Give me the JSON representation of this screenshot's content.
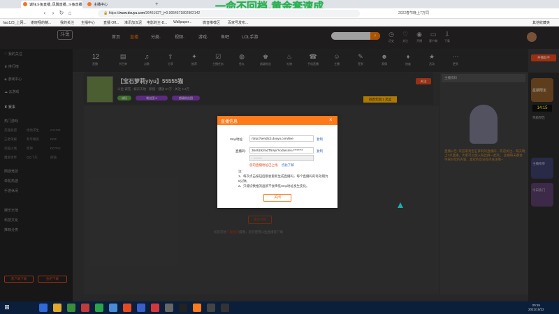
{
  "browser": {
    "tabs": [
      {
        "label": "诚钰斗鱼直播_凤翼直播_斗鱼直播",
        "active": true
      },
      {
        "label": "主播中心",
        "active": false
      }
    ],
    "new_tab": "+",
    "url_host": "www.douyu.com",
    "url_path": "/3646192?_j=0.9054571802902142",
    "url_prefix": "https://",
    "news_hint": "2022春节晚上7万同"
  },
  "banner": {
    "text": "一命不回档,黄金套速成"
  },
  "bookmarks": [
    "hao123_上网...",
    "谢晓翔的精...",
    "我的关注",
    "主播中心",
    "直播 Off...",
    "准讯加汉泥",
    "电影的主-D...",
    "Wallpaper...",
    "微音推荐区",
    "百家号发布..."
  ],
  "bookmarks_right": "其他收藏夹",
  "header": {
    "logo": "斗鱼",
    "nav": [
      {
        "label": "首页",
        "on": false
      },
      {
        "label": "直播",
        "on": true
      },
      {
        "label": "分类·",
        "on": false
      },
      {
        "label": "视频·",
        "on": false
      },
      {
        "label": "游戏·",
        "on": false
      },
      {
        "label": "鱼吧",
        "on": false
      },
      {
        "label": "LOL手游",
        "on": false
      }
    ],
    "search_icon": "search-icon",
    "icons": [
      "历史",
      "关注",
      "开播",
      "客户端",
      "下载"
    ]
  },
  "sidebar": {
    "items": [
      "我的关注",
      "排行榜",
      "游戏中心",
      "云游戏",
      "赛事",
      "热门游戏",
      "网游竞技",
      "单机热游",
      "手游休闲",
      "娱乐天地",
      "科技文化",
      "推荐分类"
    ],
    "sub": [
      [
        "英雄联盟",
        "绝地求生",
        "CS:GO"
      ],
      [
        "王者荣耀",
        "和平精英",
        "DNF"
      ],
      [
        "穿越火线",
        "原神",
        "DOTA2"
      ],
      [
        "魔兽世界",
        "QQ飞车",
        "颜值"
      ]
    ],
    "buttons": [
      "客户端下载",
      "鱼吧下载"
    ]
  },
  "toolbar": {
    "count": "12",
    "count_label": "直播",
    "items": [
      "节目单",
      "点歌",
      "分享",
      "推荐",
      "主播任务",
      "鱼丸",
      "超级粉丝",
      "礼物",
      "手机直播",
      "主播",
      "签到",
      "表情",
      "热度",
      "活动",
      "更多"
    ],
    "right_button": "开播助手"
  },
  "room": {
    "title": "【宝石萝莉yiyu】55555猫",
    "meta": "斗鱼 诚钰 · 娱乐天地 · 颜值 · 播放 57万 · 关注 4.3万",
    "pills": [
      "诚钰",
      "粉丝团 6",
      "超级粉丝团"
    ],
    "tag": "四百年回 1 次运",
    "follow": "关注"
  },
  "modal": {
    "title": "直播信息",
    "close_icon": "×",
    "rtmp_label": "rtmp地址:",
    "rtmp_value": "rtmp://sendtc3.douyu.com/live",
    "code_label": "直播码:",
    "code_value": "3646192rndT5Vyir?xxSecret=********",
    "copy": "复制",
    "select_value": "· --------",
    "warning": "您的直播地址已上线",
    "help_link": "点此了解",
    "notes_title": "注:",
    "notes": [
      "1、每次点击按钮后都会重新生成直播码，每个直播码的有效期为5分钟。",
      "2、只能切换推流画质不会降低rtmp地址发生变化。"
    ],
    "close_button": "关闭"
  },
  "start_button": "重新开播",
  "footer_text_a": "如您开始",
  "footer_text_hl": "下载推流",
  "footer_text_b": "摄像，您可使用斗鱼直播客户端",
  "right_panel": {
    "top_label": "主播资料",
    "notice": "直播公告: 欢迎来到宝石萝莉的直播间，欢迎关注... 每天晚上7点直播，大家可以加入粉丝群一起玩。 主播每天都会带来好玩的内容，喜欢的话记得点关注哦~"
  },
  "far_right": {
    "badge": "星期限定",
    "timer": "14:15",
    "labels": [
      "奖励预告",
      "主播榜单",
      "今日热门"
    ]
  },
  "taskbar": {
    "time": "20:15",
    "date": "2021/10/22"
  }
}
